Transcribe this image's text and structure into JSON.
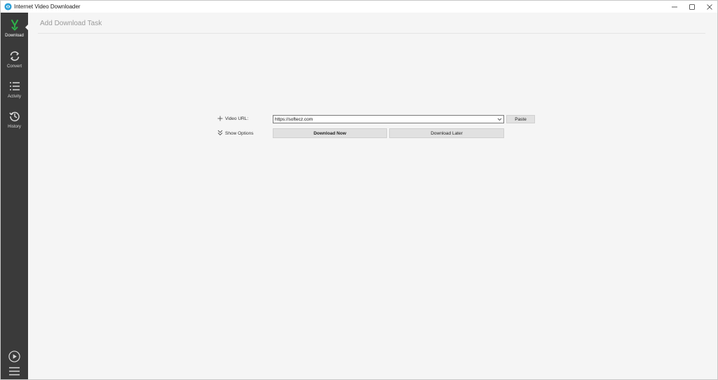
{
  "window": {
    "title": "Internet Video Downloader",
    "controls": {
      "minimize": "minimize",
      "maximize": "maximize",
      "close": "close"
    }
  },
  "sidebar": {
    "items": [
      {
        "label": "Download",
        "icon": "download-icon",
        "active": true
      },
      {
        "label": "Convert",
        "icon": "convert-icon",
        "active": false
      },
      {
        "label": "Activity",
        "icon": "list-icon",
        "active": false
      },
      {
        "label": "History",
        "icon": "history-icon",
        "active": false
      }
    ],
    "bottom": {
      "player": "play-icon",
      "menu": "hamburger-icon"
    }
  },
  "main": {
    "title": "Add Download Task",
    "video_url_label": "Video URL:",
    "video_url_value": "https://softecz.com",
    "show_options_label": "Show Options",
    "paste_button": "Paste",
    "download_now_button": "Download Now",
    "download_later_button": "Download Later"
  },
  "colors": {
    "sidebar_bg": "#3a3a3a",
    "accent_green": "#2db34a",
    "content_bg": "#f5f5f5",
    "button_bg": "#e1e1e1"
  }
}
